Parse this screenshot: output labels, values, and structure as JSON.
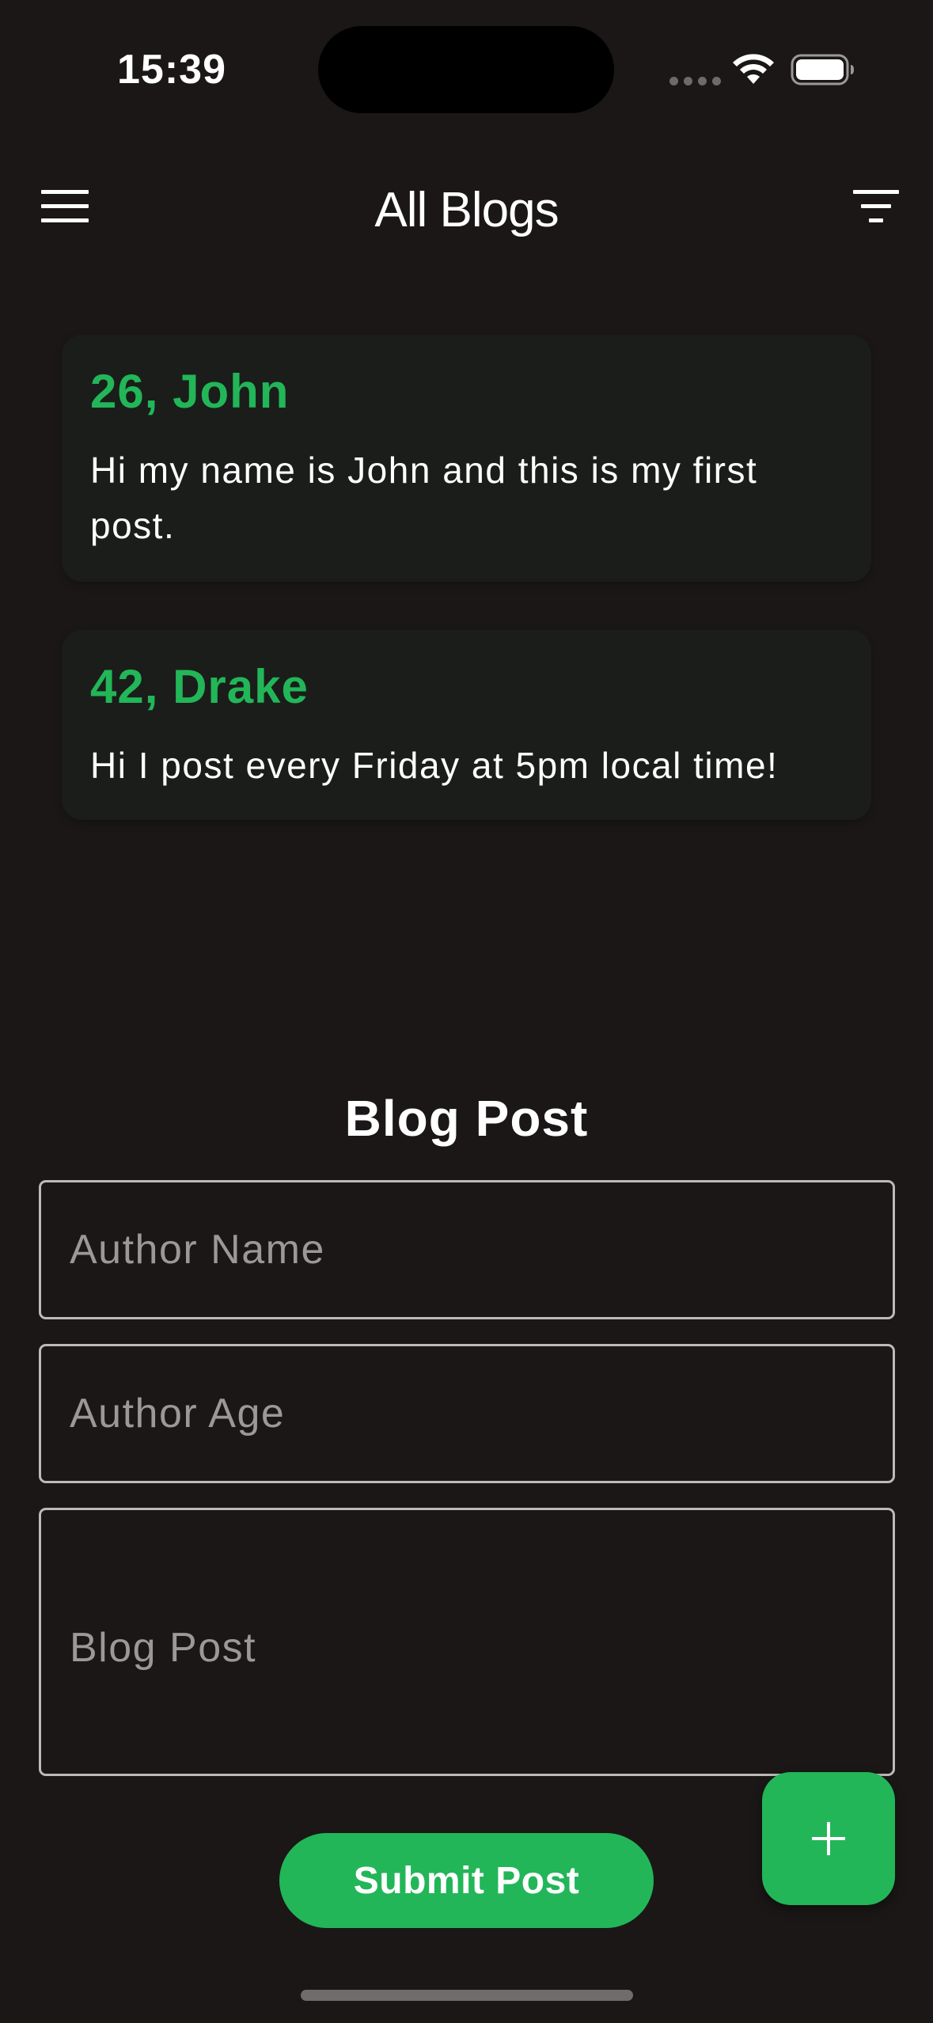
{
  "status_bar": {
    "time": "15:39"
  },
  "app_bar": {
    "title": "All Blogs",
    "menu_icon": "hamburger-menu-icon",
    "filter_icon": "filter-icon"
  },
  "posts": [
    {
      "header": "26, John",
      "body": "Hi my name is John and this is my first post."
    },
    {
      "header": "42, Drake",
      "body": "Hi I post every Friday at 5pm local time!"
    }
  ],
  "form": {
    "title": "Blog Post",
    "author_name": {
      "placeholder": "Author Name",
      "value": ""
    },
    "author_age": {
      "placeholder": "Author Age",
      "value": ""
    },
    "blog_post": {
      "placeholder": "Blog Post",
      "value": ""
    },
    "submit_label": "Submit Post"
  },
  "fab": {
    "icon": "plus-icon"
  },
  "colors": {
    "background": "#1b1717",
    "card": "#1b1d1b",
    "accent": "#22b658"
  }
}
